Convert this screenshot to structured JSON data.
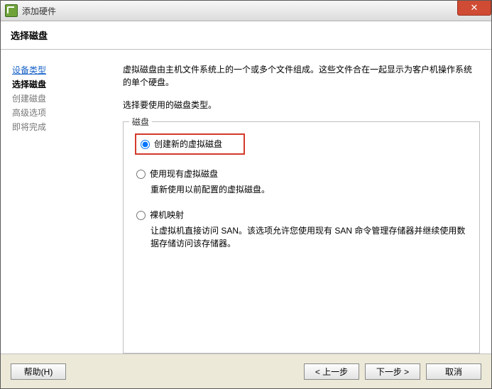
{
  "window": {
    "title": "添加硬件"
  },
  "header": {
    "title": "选择磁盘"
  },
  "sidebar": {
    "steps": {
      "s0": "设备类型",
      "s1": "选择磁盘",
      "s2": "创建磁盘",
      "s3": "高级选项",
      "s4": "即将完成"
    }
  },
  "main": {
    "desc1": "虚拟磁盘由主机文件系统上的一个或多个文件组成。这些文件合在一起显示为客户机操作系统的单个硬盘。",
    "desc2": "选择要使用的磁盘类型。",
    "groupLabel": "磁盘",
    "opt1": {
      "label": "创建新的虚拟磁盘"
    },
    "opt2": {
      "label": "使用现有虚拟磁盘",
      "sub": "重新使用以前配置的虚拟磁盘。"
    },
    "opt3": {
      "label": "裸机映射",
      "sub": "让虚拟机直接访问 SAN。该选项允许您使用现有 SAN 命令管理存储器并继续使用数据存储访问该存储器。"
    }
  },
  "footer": {
    "help": "帮助(H)",
    "back": "< 上一步",
    "next": "下一步 >",
    "cancel": "取消"
  }
}
